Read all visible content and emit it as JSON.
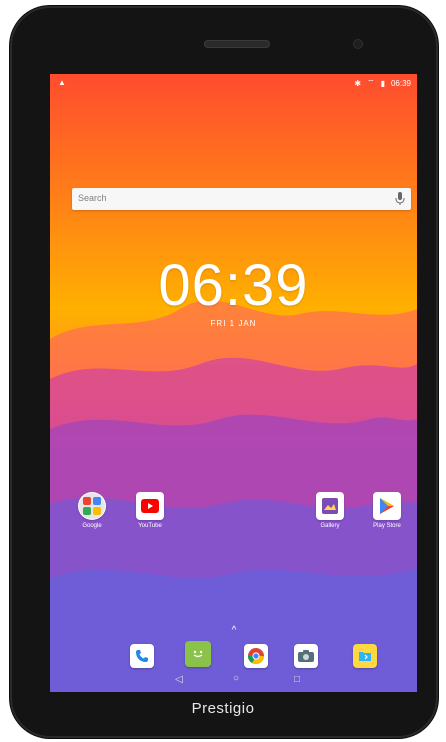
{
  "status_bar": {
    "left_icon": "warning-icon",
    "right_icons": [
      "bluetooth-icon",
      "wifi-icon",
      "battery-icon"
    ],
    "time": "06:39"
  },
  "search": {
    "placeholder": "Search",
    "mic_icon": "microphone-icon"
  },
  "clock": {
    "time": "06:39",
    "date": "FRI 1 JAN"
  },
  "apps": [
    {
      "label": "Google"
    },
    {
      "label": "YouTube"
    },
    {
      "label": "Gallery"
    },
    {
      "label": "Play Store"
    }
  ],
  "dock": [
    "phone-icon",
    "messaging-icon",
    "chrome-icon",
    "camera-icon",
    "file-manager-icon"
  ],
  "nav": {
    "back_icon": "back-icon",
    "home_icon": "home-icon",
    "recents_icon": "recents-icon"
  },
  "brand": "Prestigio",
  "colors": {
    "screen_top": "#ff4c2f",
    "screen_mid": "#ffb000",
    "screen_bottom": "#5a63db",
    "bezel": "#141414"
  }
}
